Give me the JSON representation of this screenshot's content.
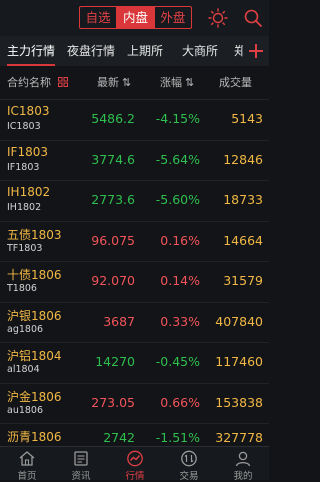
{
  "top": {
    "segments": [
      "自选",
      "内盘",
      "外盘"
    ],
    "active_segment": "内盘"
  },
  "category_tabs": [
    "主力行情",
    "夜盘行情",
    "上期所",
    "大商所",
    "郑"
  ],
  "columns": {
    "name": "合约名称",
    "price": "最新",
    "change": "涨幅",
    "volume": "成交量"
  },
  "rows": [
    {
      "name": "IC1803",
      "code": "IC1803",
      "price": "5486.2",
      "change": "-4.15%",
      "volume": "5143",
      "dir": "down"
    },
    {
      "name": "IF1803",
      "code": "IF1803",
      "price": "3774.6",
      "change": "-5.64%",
      "volume": "12846",
      "dir": "down"
    },
    {
      "name": "IH1802",
      "code": "IH1802",
      "price": "2773.6",
      "change": "-5.60%",
      "volume": "18733",
      "dir": "down"
    },
    {
      "name": "五债1803",
      "code": "TF1803",
      "price": "96.075",
      "change": "0.16%",
      "volume": "14664",
      "dir": "up"
    },
    {
      "name": "十债1806",
      "code": "T1806",
      "price": "92.070",
      "change": "0.14%",
      "volume": "31579",
      "dir": "up"
    },
    {
      "name": "沪银1806",
      "code": "ag1806",
      "price": "3687",
      "change": "0.33%",
      "volume": "407840",
      "dir": "up"
    },
    {
      "name": "沪铝1804",
      "code": "al1804",
      "price": "14270",
      "change": "-0.45%",
      "volume": "117460",
      "dir": "down"
    },
    {
      "name": "沪金1806",
      "code": "au1806",
      "price": "273.05",
      "change": "0.66%",
      "volume": "153838",
      "dir": "up"
    },
    {
      "name": "沥青1806",
      "code": "",
      "price": "2742",
      "change": "-1.51%",
      "volume": "327778",
      "dir": "down"
    }
  ],
  "bottom_nav": [
    {
      "label": "首页",
      "icon": "home-icon"
    },
    {
      "label": "资讯",
      "icon": "news-icon"
    },
    {
      "label": "行情",
      "icon": "chart-icon",
      "active": true
    },
    {
      "label": "交易",
      "icon": "trade-icon"
    },
    {
      "label": "我的",
      "icon": "profile-icon"
    }
  ],
  "colors": {
    "accent": "#d9373a",
    "up": "#f2545b",
    "down": "#2fbf4f",
    "name": "#f2b845"
  }
}
